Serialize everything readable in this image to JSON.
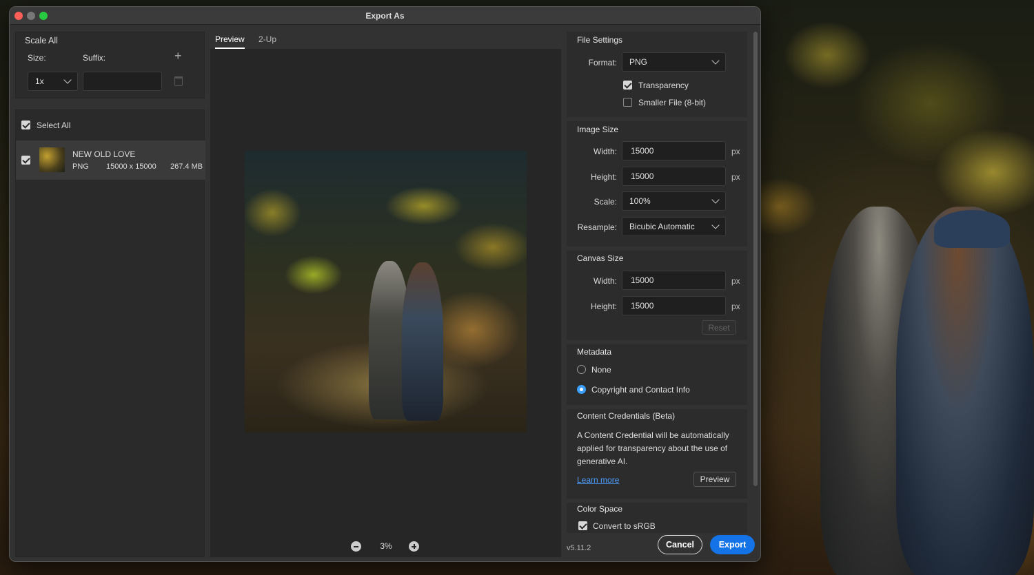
{
  "window": {
    "title": "Export As",
    "version": "v5.11.2"
  },
  "scale_all": {
    "heading": "Scale All",
    "size_label": "Size:",
    "suffix_label": "Suffix:",
    "size_value": "1x",
    "suffix_value": ""
  },
  "asset_list": {
    "select_all_label": "Select All",
    "items": [
      {
        "name": "NEW OLD LOVE",
        "format": "PNG",
        "dimensions": "15000 x 15000",
        "size": "267.4 MB",
        "checked": true
      }
    ]
  },
  "preview": {
    "tabs": [
      "Preview",
      "2-Up"
    ],
    "zoom": "3%"
  },
  "file_settings": {
    "heading": "File Settings",
    "format_label": "Format:",
    "format_value": "PNG",
    "transparency_label": "Transparency",
    "smaller_file_label": "Smaller File (8-bit)"
  },
  "image_size": {
    "heading": "Image Size",
    "width_label": "Width:",
    "width_value": "15000",
    "height_label": "Height:",
    "height_value": "15000",
    "scale_label": "Scale:",
    "scale_value": "100%",
    "resample_label": "Resample:",
    "resample_value": "Bicubic Automatic",
    "unit": "px"
  },
  "canvas_size": {
    "heading": "Canvas Size",
    "width_label": "Width:",
    "width_value": "15000",
    "height_label": "Height:",
    "height_value": "15000",
    "unit": "px",
    "reset_label": "Reset"
  },
  "metadata": {
    "heading": "Metadata",
    "option_none": "None",
    "option_copyright": "Copyright and Contact Info"
  },
  "content_credentials": {
    "heading": "Content Credentials (Beta)",
    "line1": "A Content Credential will be automatically",
    "line2": "applied for transparency about the use of",
    "line3": "generative AI.",
    "learn_more": "Learn more",
    "preview_button": "Preview"
  },
  "color_space": {
    "heading": "Color Space",
    "convert_label": "Convert to sRGB"
  },
  "footer": {
    "cancel": "Cancel",
    "export": "Export"
  },
  "colors": {
    "accent": "#1473e6",
    "radio": "#3aa0ff"
  }
}
